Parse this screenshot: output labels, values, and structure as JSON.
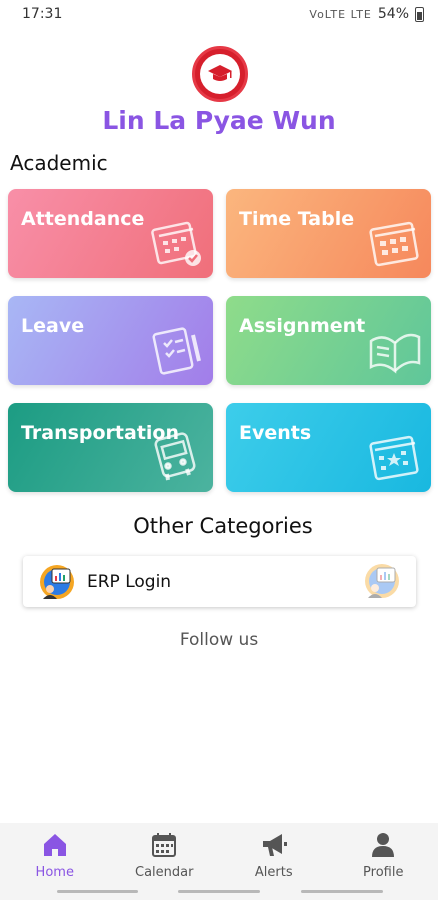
{
  "status_bar": {
    "time": "17:31",
    "icons": "VoLTE LTE",
    "battery": "54%"
  },
  "header": {
    "school_name": "Lin La Pyae Wun",
    "logo_icon": "school-crest-icon"
  },
  "academic": {
    "title": "Academic",
    "tiles": [
      {
        "label": "Attendance",
        "icon": "calendar-check-icon"
      },
      {
        "label": "Time Table",
        "icon": "calendar-grid-icon"
      },
      {
        "label": "Leave",
        "icon": "clipboard-pencil-icon"
      },
      {
        "label": "Assignment",
        "icon": "open-book-icon"
      },
      {
        "label": "Transportation",
        "icon": "bus-icon"
      },
      {
        "label": "Events",
        "icon": "calendar-star-icon"
      }
    ]
  },
  "other": {
    "title": "Other Categories",
    "erp": {
      "label": "ERP Login",
      "icon": "erp-chart-icon"
    }
  },
  "follow": {
    "label": "Follow us"
  },
  "bottom_nav": {
    "items": [
      {
        "label": "Home",
        "icon": "home-icon",
        "active": true
      },
      {
        "label": "Calendar",
        "icon": "calendar-icon",
        "active": false
      },
      {
        "label": "Alerts",
        "icon": "megaphone-icon",
        "active": false
      },
      {
        "label": "Profile",
        "icon": "person-icon",
        "active": false
      }
    ]
  },
  "colors": {
    "accent": "#8a55e3",
    "logo_red": "#d61f2c"
  }
}
